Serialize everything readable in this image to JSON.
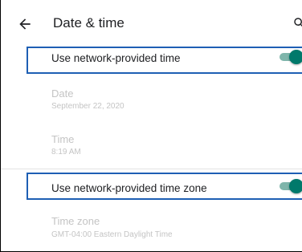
{
  "header": {
    "title": "Date & time",
    "back_icon": "arrow-back-icon",
    "search_icon": "search-icon"
  },
  "settings": {
    "network_time": {
      "label": "Use network-provided time",
      "enabled": true
    },
    "date": {
      "title": "Date",
      "value": "September 22, 2020"
    },
    "time": {
      "title": "Time",
      "value": "8:19 AM"
    },
    "network_time_zone": {
      "label": "Use network-provided time zone",
      "enabled": true
    },
    "time_zone": {
      "title": "Time zone",
      "value": "GMT-04:00 Eastern Daylight Time"
    }
  },
  "colors": {
    "accent": "#00796b",
    "switch_track": "#7fb5ab",
    "highlight_border": "#1e5fb4",
    "disabled_text": "#c4c4c4"
  }
}
